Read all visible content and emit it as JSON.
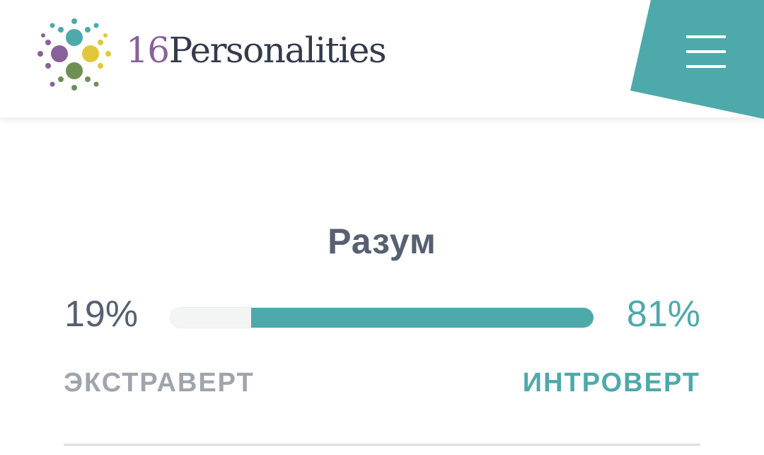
{
  "header": {
    "logo": {
      "number": "16",
      "word": "Personalities"
    },
    "menu_icon": "hamburger-icon",
    "colors": {
      "accent": "#4ea9aa",
      "logo_number": "#88619a",
      "logo_word": "#343c4b"
    }
  },
  "trait": {
    "title": "Разум",
    "left": {
      "percent": "19%",
      "label": "ЭКСТРАВЕРТ"
    },
    "right": {
      "percent": "81%",
      "label": "ИНТРОВЕРТ"
    },
    "fill_fraction": 0.81,
    "fill_color": "#4ea9aa"
  }
}
